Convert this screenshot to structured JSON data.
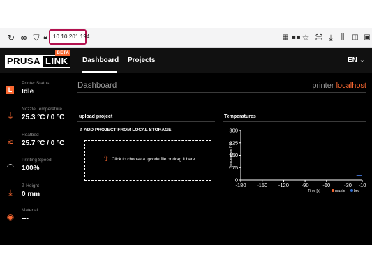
{
  "browser": {
    "url": "10.10.201.194",
    "icons": [
      "reload-icon",
      "infinity-icon",
      "shield-icon",
      "lock-icon",
      "qr-icon",
      "grid-icon",
      "star-icon",
      "puzzle-icon",
      "download-icon",
      "library-icon",
      "sidebar-icon",
      "account-icon"
    ]
  },
  "nav": {
    "logo_prusa": "PRUSA",
    "logo_link": "LINK",
    "logo_beta": "BETA",
    "dashboard": "Dashboard",
    "projects": "Projects",
    "language": "EN",
    "chevron": "⌄"
  },
  "sidebar": [
    {
      "label": "Printer Status",
      "value": "Idle",
      "icon": "printer-status-icon",
      "glyph": "L"
    },
    {
      "label": "Nozzle Temperature",
      "value": "25.3 °C / 0 °C",
      "icon": "nozzle-icon",
      "glyph": "⏚"
    },
    {
      "label": "Heatbed",
      "value": "25.7 °C / 0 °C",
      "icon": "heatbed-icon",
      "glyph": "≋"
    },
    {
      "label": "Printing Speed",
      "value": "100%",
      "icon": "speedometer-icon",
      "glyph": "◠"
    },
    {
      "label": "Z-Height",
      "value": "0 mm",
      "icon": "z-height-icon",
      "glyph": "⤓"
    },
    {
      "label": "Material",
      "value": "---",
      "icon": "material-icon",
      "glyph": "◉"
    }
  ],
  "main": {
    "title": "Dashboard",
    "printer_label": "printer",
    "printer_host": "localhost"
  },
  "upload": {
    "title": "upload project",
    "add_label": "ADD PROJECT FROM LOCAL STORAGE",
    "drop_text": "Click to choose a .gcode file or drag it here"
  },
  "colors": {
    "accent": "#fa6831",
    "nozzle": "#fa6831",
    "bed": "#2f6fd6"
  },
  "chart_data": {
    "type": "line",
    "title": "Temperatures",
    "xlabel": "Time [s]",
    "ylabel": "Temperature [°C]",
    "xlim": [
      -180,
      -10
    ],
    "ylim": [
      0,
      300
    ],
    "x_ticks": [
      -180,
      -150,
      -120,
      -90,
      -60,
      -30,
      -10
    ],
    "y_ticks": [
      0,
      75,
      150,
      225,
      300
    ],
    "grid": false,
    "legend_placement": "bottom-right",
    "series": [
      {
        "name": "nozzle",
        "color": "#fa6831",
        "x": [
          -18,
          -10
        ],
        "y": [
          25.3,
          25.3
        ]
      },
      {
        "name": "bed",
        "color": "#2f6fd6",
        "x": [
          -18,
          -10
        ],
        "y": [
          25.7,
          25.7
        ]
      }
    ]
  }
}
